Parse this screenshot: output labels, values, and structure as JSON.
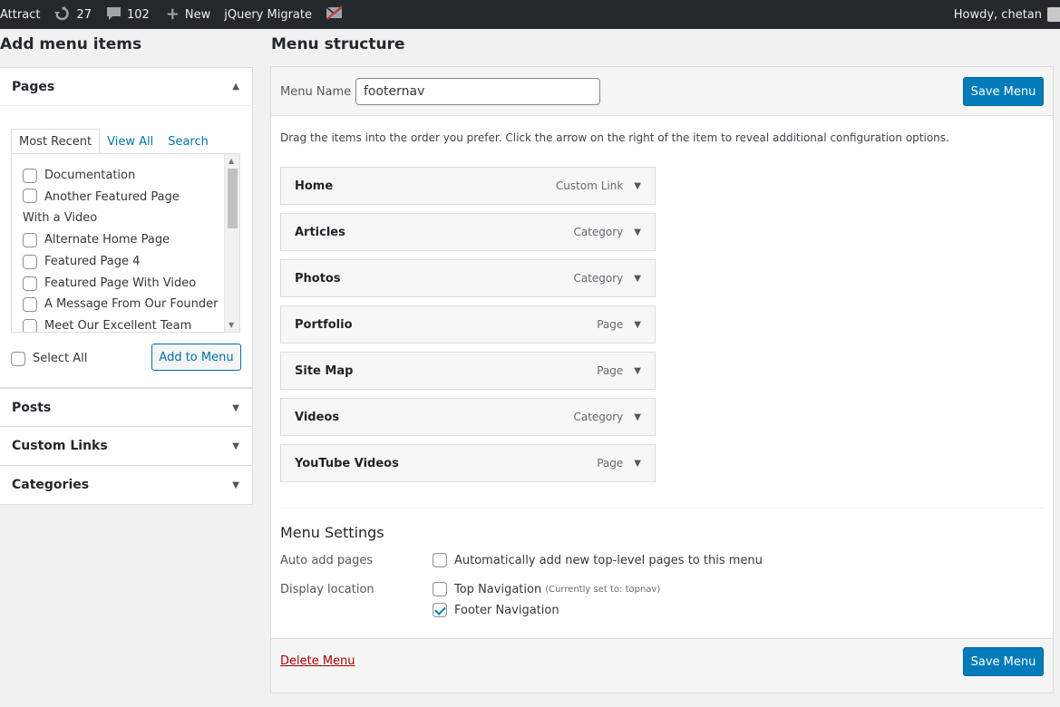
{
  "adminbar": {
    "site_name": "Attract",
    "updates_count": "27",
    "comments_count": "102",
    "new_label": "New",
    "plugin_label": "jQuery Migrate",
    "howdy": "Howdy, chetan"
  },
  "left": {
    "title": "Add menu items",
    "pages": {
      "heading": "Pages",
      "tabs": [
        "Most Recent",
        "View All",
        "Search"
      ],
      "items": [
        "Documentation",
        "Another Featured Page With a Video",
        "Alternate Home Page",
        "Featured Page 4",
        "Featured Page With Video",
        "A Message From Our Founder",
        "Meet Our Excellent Team"
      ],
      "select_all": "Select All",
      "add_button": "Add to Menu"
    },
    "sections": [
      "Posts",
      "Custom Links",
      "Categories"
    ]
  },
  "right": {
    "title": "Menu structure",
    "menu_name_label": "Menu Name",
    "menu_name_value": "footernav",
    "save_label": "Save Menu",
    "instructions": "Drag the items into the order you prefer. Click the arrow on the right of the item to reveal additional configuration options.",
    "menu_items": [
      {
        "title": "Home",
        "type": "Custom Link"
      },
      {
        "title": "Articles",
        "type": "Category"
      },
      {
        "title": "Photos",
        "type": "Category"
      },
      {
        "title": "Portfolio",
        "type": "Page"
      },
      {
        "title": "Site Map",
        "type": "Page"
      },
      {
        "title": "Videos",
        "type": "Category"
      },
      {
        "title": "YouTube Videos",
        "type": "Page"
      }
    ],
    "settings": {
      "heading": "Menu Settings",
      "auto_add_label": "Auto add pages",
      "auto_add_option": "Automatically add new top-level pages to this menu",
      "display_location_label": "Display location",
      "locations": [
        {
          "name": "Top Navigation",
          "note": "(Currently set to: topnav)",
          "checked": false
        },
        {
          "name": "Footer Navigation",
          "note": "",
          "checked": true
        }
      ]
    },
    "delete_label": "Delete Menu"
  },
  "colors": {
    "adminbar_bg": "#23282d",
    "primary": "#007cba",
    "link": "#0073aa",
    "delete": "#a00"
  }
}
